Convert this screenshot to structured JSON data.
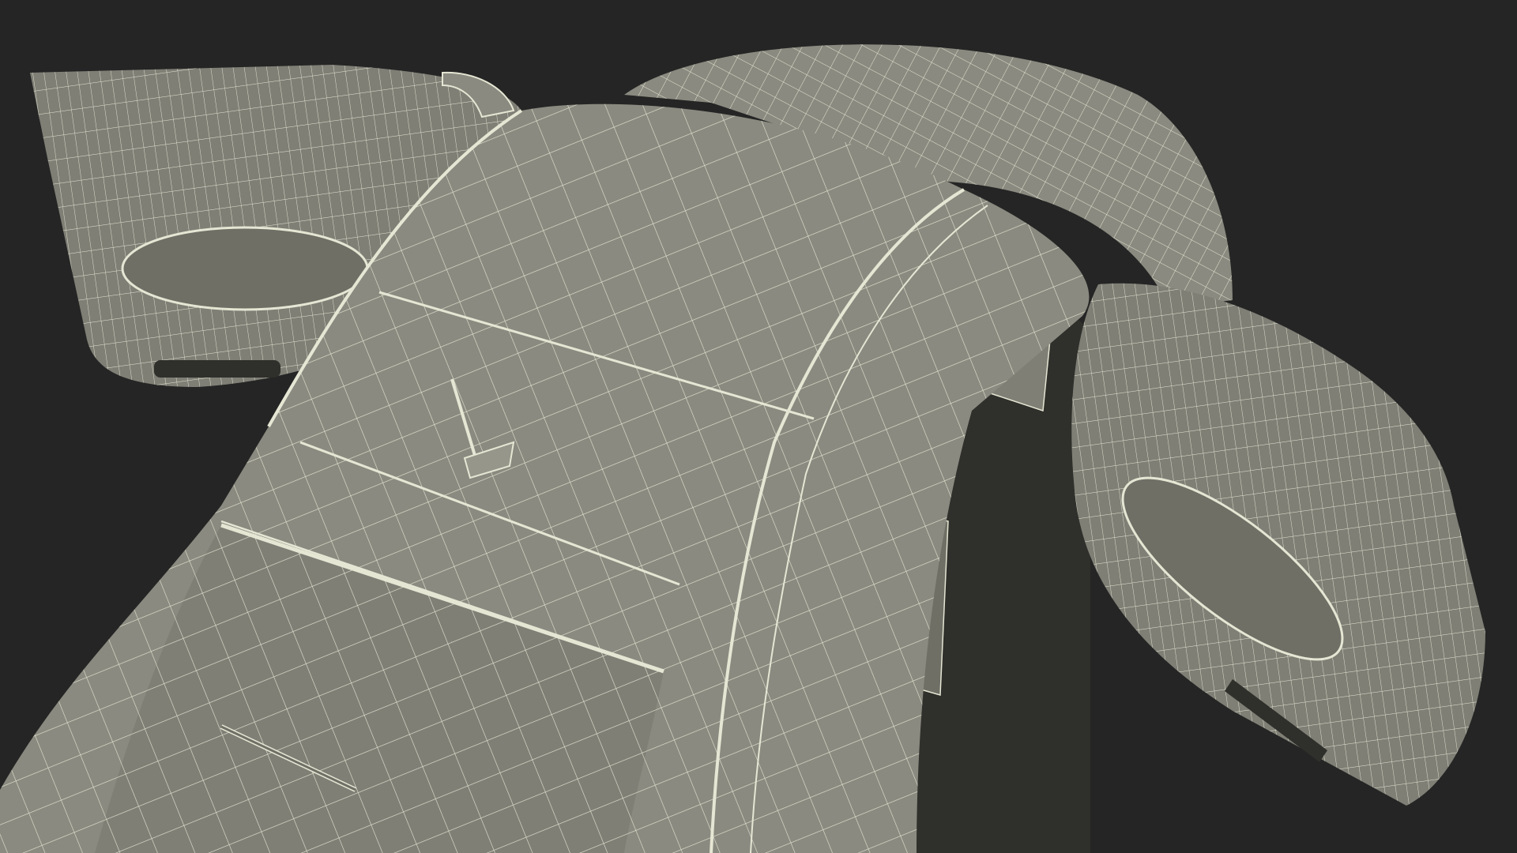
{
  "scene": {
    "subject": "car-wireframe-render",
    "colors": {
      "background": "#252525",
      "surface": "#8a8a80",
      "surface_light": "#96968b",
      "surface_dark": "#6f6f66",
      "interior": "#2f2f2b",
      "wire": "#e6e6d4"
    }
  }
}
